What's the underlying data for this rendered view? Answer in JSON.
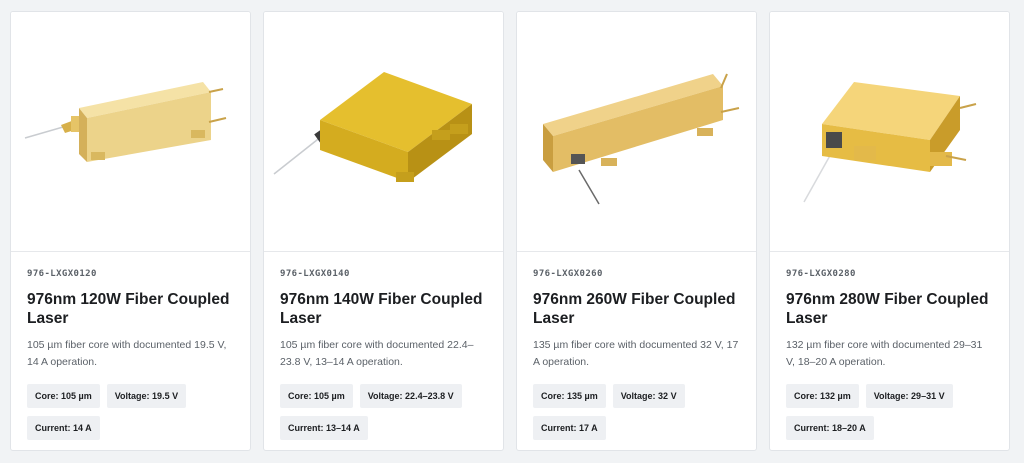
{
  "products": [
    {
      "sku": "976-LXGX0120",
      "title": "976nm 120W Fiber Coupled Laser",
      "description": "105 µm fiber core with documented 19.5 V, 14 A operation.",
      "specs": [
        "Core: 105 µm",
        "Voltage: 19.5 V",
        "Current: 14 A"
      ],
      "image": "laser-module-icon"
    },
    {
      "sku": "976-LXGX0140",
      "title": "976nm 140W Fiber Coupled Laser",
      "description": "105 µm fiber core with documented 22.4–23.8 V, 13–14 A operation.",
      "specs": [
        "Core: 105 µm",
        "Voltage: 22.4–23.8 V",
        "Current: 13–14 A"
      ],
      "image": "laser-module-icon"
    },
    {
      "sku": "976-LXGX0260",
      "title": "976nm 260W Fiber Coupled Laser",
      "description": "135 µm fiber core with documented 32 V, 17 A operation.",
      "specs": [
        "Core: 135 µm",
        "Voltage: 32 V",
        "Current: 17 A"
      ],
      "image": "laser-module-icon"
    },
    {
      "sku": "976-LXGX0280",
      "title": "976nm 280W Fiber Coupled Laser",
      "description": "132 µm fiber core with documented 29–31 V, 18–20 A operation.",
      "specs": [
        "Core: 132 µm",
        "Voltage: 29–31 V",
        "Current: 18–20 A"
      ],
      "image": "laser-module-icon"
    }
  ],
  "colors": {
    "gold_light": "#f3d98a",
    "gold_mid": "#e2bd55",
    "gold_dark": "#b88f2a",
    "page_bg": "#f1f3f5",
    "chip_bg": "#eef0f3"
  }
}
